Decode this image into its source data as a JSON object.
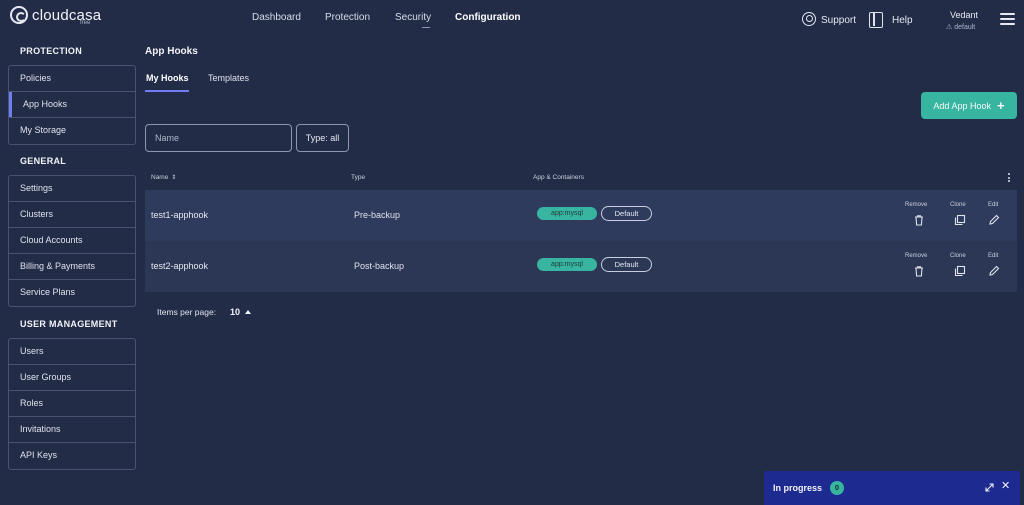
{
  "brand": {
    "name": "cloudcasa",
    "tier": "free"
  },
  "nav": {
    "items": [
      "Dashboard",
      "Protection",
      "Security",
      "Configuration"
    ],
    "active": "Configuration"
  },
  "header": {
    "support_label": "Support",
    "help_label": "Help",
    "user_name": "Vedant",
    "user_org": "default"
  },
  "sidebar": {
    "protection_title": "PROTECTION",
    "protection_items": [
      "Policies",
      "App Hooks",
      "My Storage"
    ],
    "general_title": "GENERAL",
    "general_items": [
      "Settings",
      "Clusters",
      "Cloud Accounts",
      "Billing & Payments",
      "Service Plans"
    ],
    "user_title": "USER MANAGEMENT",
    "user_items": [
      "Users",
      "User Groups",
      "Roles",
      "Invitations",
      "API Keys"
    ],
    "active_item": "App Hooks"
  },
  "main": {
    "title": "App Hooks",
    "tabs": [
      "My Hooks",
      "Templates"
    ],
    "active_tab": "My Hooks",
    "add_button_label": "Add App Hook",
    "name_placeholder": "Name",
    "type_filter_label": "Type: all",
    "columns": [
      "Name",
      "Type",
      "App & Containers"
    ],
    "actions": [
      "Remove",
      "Clone",
      "Edit"
    ],
    "rows": [
      {
        "name": "test1-apphook",
        "type": "Pre-backup",
        "app_chip": "app:mysql",
        "default_label": "Default"
      },
      {
        "name": "test2-apphook",
        "type": "Post-backup",
        "app_chip": "app:mysql",
        "default_label": "Default"
      }
    ],
    "pager_label": "Items per page:",
    "pager_value": "10"
  },
  "progress": {
    "label": "In progress",
    "count": "0"
  },
  "colors": {
    "background": "#232c47",
    "accent": "#38b5a0",
    "nav_accent": "#6f7cf2",
    "progress_bg": "#1d2a8f"
  }
}
